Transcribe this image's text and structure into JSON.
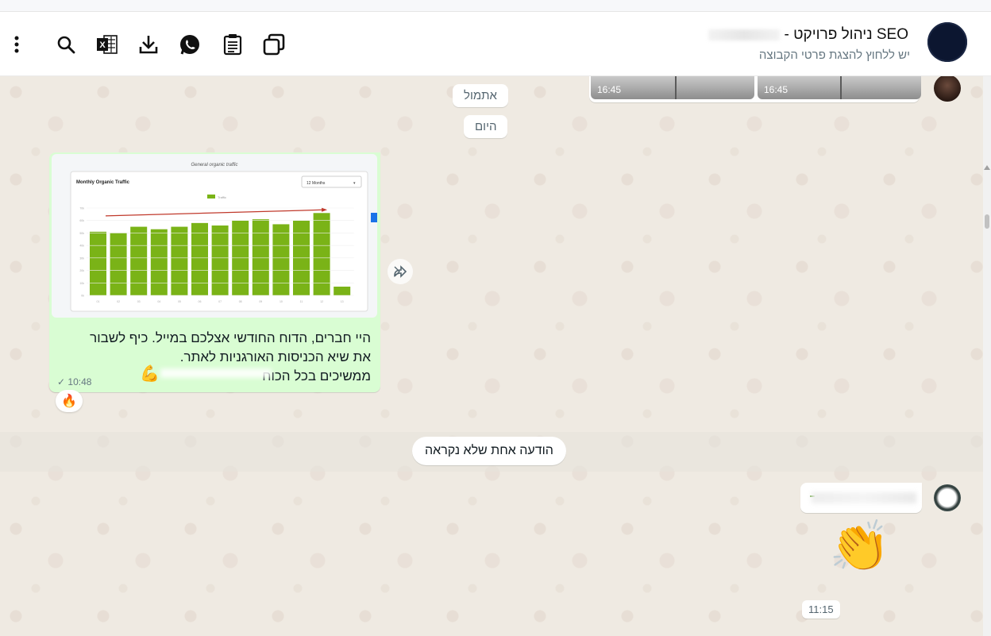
{
  "header": {
    "title_text": "SEO ניהול פרויקט -",
    "subtitle": "יש ללחוץ להצגת פרטי הקבוצה",
    "icons": [
      "more-icon",
      "search-icon",
      "excel-icon",
      "download-icon",
      "whatsapp-icon",
      "clipboard-icon",
      "windows-icon"
    ]
  },
  "top_images": {
    "time_left": "16:45",
    "time_right": "16:45"
  },
  "date_pills": {
    "yesterday": "אתמול",
    "today": "היום"
  },
  "outgoing_message": {
    "chart": {
      "caption": "General organic traffic",
      "panel_title": "Monthly Organic Traffic",
      "dropdown": "12 Months",
      "legend": "Traffic"
    },
    "lines": [
      "היי חברים, הדוח החודשי אצלכם במייל. כיף לשבור",
      "את שיא הכניסות האורגניות לאתר.",
      "ממשיכים בכל הכוח"
    ],
    "time": "10:48",
    "reaction": "🔥"
  },
  "unread_label": "הודעה אחת שלא נקראה",
  "incoming": {
    "emoji": "👏",
    "time": "11:15"
  },
  "chart_data": {
    "type": "bar",
    "title": "Monthly Organic Traffic",
    "subtitle": "General organic traffic",
    "legend": [
      "Traffic"
    ],
    "categories": [
      "01",
      "02",
      "03",
      "04",
      "05",
      "06",
      "07",
      "08",
      "09",
      "10",
      "11",
      "12",
      "13"
    ],
    "values": [
      51,
      50,
      55,
      53,
      55,
      58,
      56,
      60,
      61,
      57,
      60,
      66,
      7
    ],
    "ylim": [
      0,
      70
    ],
    "trend_arrow": true,
    "colors": {
      "bar": "#7ab317",
      "arrow": "#c0392b"
    }
  }
}
